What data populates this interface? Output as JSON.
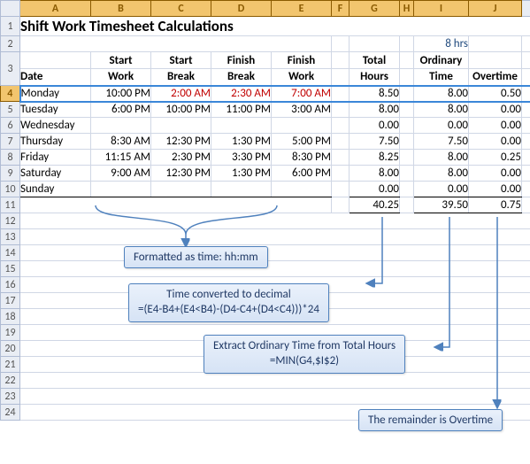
{
  "title": "Shift Work Timesheet Calculations",
  "threshold_label": "8 hrs",
  "col_headers": [
    "",
    "A",
    "B",
    "C",
    "D",
    "E",
    "F",
    "G",
    "H",
    "I",
    "J",
    ""
  ],
  "row_headers": [
    "1",
    "2",
    "3",
    "4",
    "5",
    "6",
    "7",
    "8",
    "9",
    "10",
    "11",
    "12",
    "13",
    "14",
    "15",
    "16",
    "17",
    "18",
    "19",
    "20",
    "21",
    "22",
    "23",
    "24"
  ],
  "hdr": {
    "date": "Date",
    "start_work_1": "Start",
    "start_work_2": "Work",
    "start_break_1": "Start",
    "start_break_2": "Break",
    "finish_break_1": "Finish",
    "finish_break_2": "Break",
    "finish_work_1": "Finish",
    "finish_work_2": "Work",
    "total_hours_1": "Total",
    "total_hours_2": "Hours",
    "ordinary_1": "Ordinary",
    "ordinary_2": "Time",
    "overtime": "Overtime"
  },
  "annotations": {
    "fmt": "Formatted as time: hh:mm",
    "decimal_1": "Time converted to decimal",
    "decimal_2": "=(E4-B4+(E4<B4)-(D4-C4+(D4<C4)))*24",
    "ordinary_1": "Extract Ordinary Time from Total Hours",
    "ordinary_2": "=MIN(G4,$I$2)",
    "overtime": "The remainder is Overtime"
  },
  "rows": [
    {
      "day": "Monday",
      "sw": "10:00 PM",
      "sb": "2:00 AM",
      "fb": "2:30 AM",
      "fw": "7:00 AM",
      "tot": "8.50",
      "ord": "8.00",
      "ot": "0.50",
      "red": true
    },
    {
      "day": "Tuesday",
      "sw": "6:00 PM",
      "sb": "10:00 PM",
      "fb": "11:00 PM",
      "fw": "3:00 AM",
      "tot": "8.00",
      "ord": "8.00",
      "ot": "0.00"
    },
    {
      "day": "Wednesday",
      "sw": "",
      "sb": "",
      "fb": "",
      "fw": "",
      "tot": "0.00",
      "ord": "0.00",
      "ot": "0.00"
    },
    {
      "day": "Thursday",
      "sw": "8:30 AM",
      "sb": "12:30 PM",
      "fb": "1:30 PM",
      "fw": "5:00 PM",
      "tot": "7.50",
      "ord": "7.50",
      "ot": "0.00"
    },
    {
      "day": "Friday",
      "sw": "11:15 AM",
      "sb": "2:30 PM",
      "fb": "3:30 PM",
      "fw": "8:30 PM",
      "tot": "8.25",
      "ord": "8.00",
      "ot": "0.25"
    },
    {
      "day": "Saturday",
      "sw": "9:00 AM",
      "sb": "12:30 PM",
      "fb": "1:30 PM",
      "fw": "6:00 PM",
      "tot": "8.00",
      "ord": "8.00",
      "ot": "0.00"
    },
    {
      "day": "Sunday",
      "sw": "",
      "sb": "",
      "fb": "",
      "fw": "",
      "tot": "0.00",
      "ord": "0.00",
      "ot": "0.00"
    }
  ],
  "totals": {
    "tot": "40.25",
    "ord": "39.50",
    "ot": "0.75"
  },
  "chart_data": {
    "type": "table",
    "title": "Shift Work Timesheet Calculations",
    "ordinary_threshold_hours": 8,
    "columns": [
      "Date",
      "Start Work",
      "Start Break",
      "Finish Break",
      "Finish Work",
      "Total Hours",
      "Ordinary Time",
      "Overtime"
    ],
    "rows": [
      [
        "Monday",
        "10:00 PM",
        "2:00 AM",
        "2:30 AM",
        "7:00 AM",
        8.5,
        8.0,
        0.5
      ],
      [
        "Tuesday",
        "6:00 PM",
        "10:00 PM",
        "11:00 PM",
        "3:00 AM",
        8.0,
        8.0,
        0.0
      ],
      [
        "Wednesday",
        "",
        "",
        "",
        "",
        0.0,
        0.0,
        0.0
      ],
      [
        "Thursday",
        "8:30 AM",
        "12:30 PM",
        "1:30 PM",
        "5:00 PM",
        7.5,
        7.5,
        0.0
      ],
      [
        "Friday",
        "11:15 AM",
        "2:30 PM",
        "3:30 PM",
        "8:30 PM",
        8.25,
        8.0,
        0.25
      ],
      [
        "Saturday",
        "9:00 AM",
        "12:30 PM",
        "1:30 PM",
        "6:00 PM",
        8.0,
        8.0,
        0.0
      ],
      [
        "Sunday",
        "",
        "",
        "",
        "",
        0.0,
        0.0,
        0.0
      ]
    ],
    "totals": {
      "Total Hours": 40.25,
      "Ordinary Time": 39.5,
      "Overtime": 0.75
    },
    "formulas": {
      "total_hours": "=(E4-B4+(E4<B4)-(D4-C4+(D4<C4)))*24",
      "ordinary_time": "=MIN(G4,$I$2)",
      "time_format": "hh:mm"
    }
  }
}
